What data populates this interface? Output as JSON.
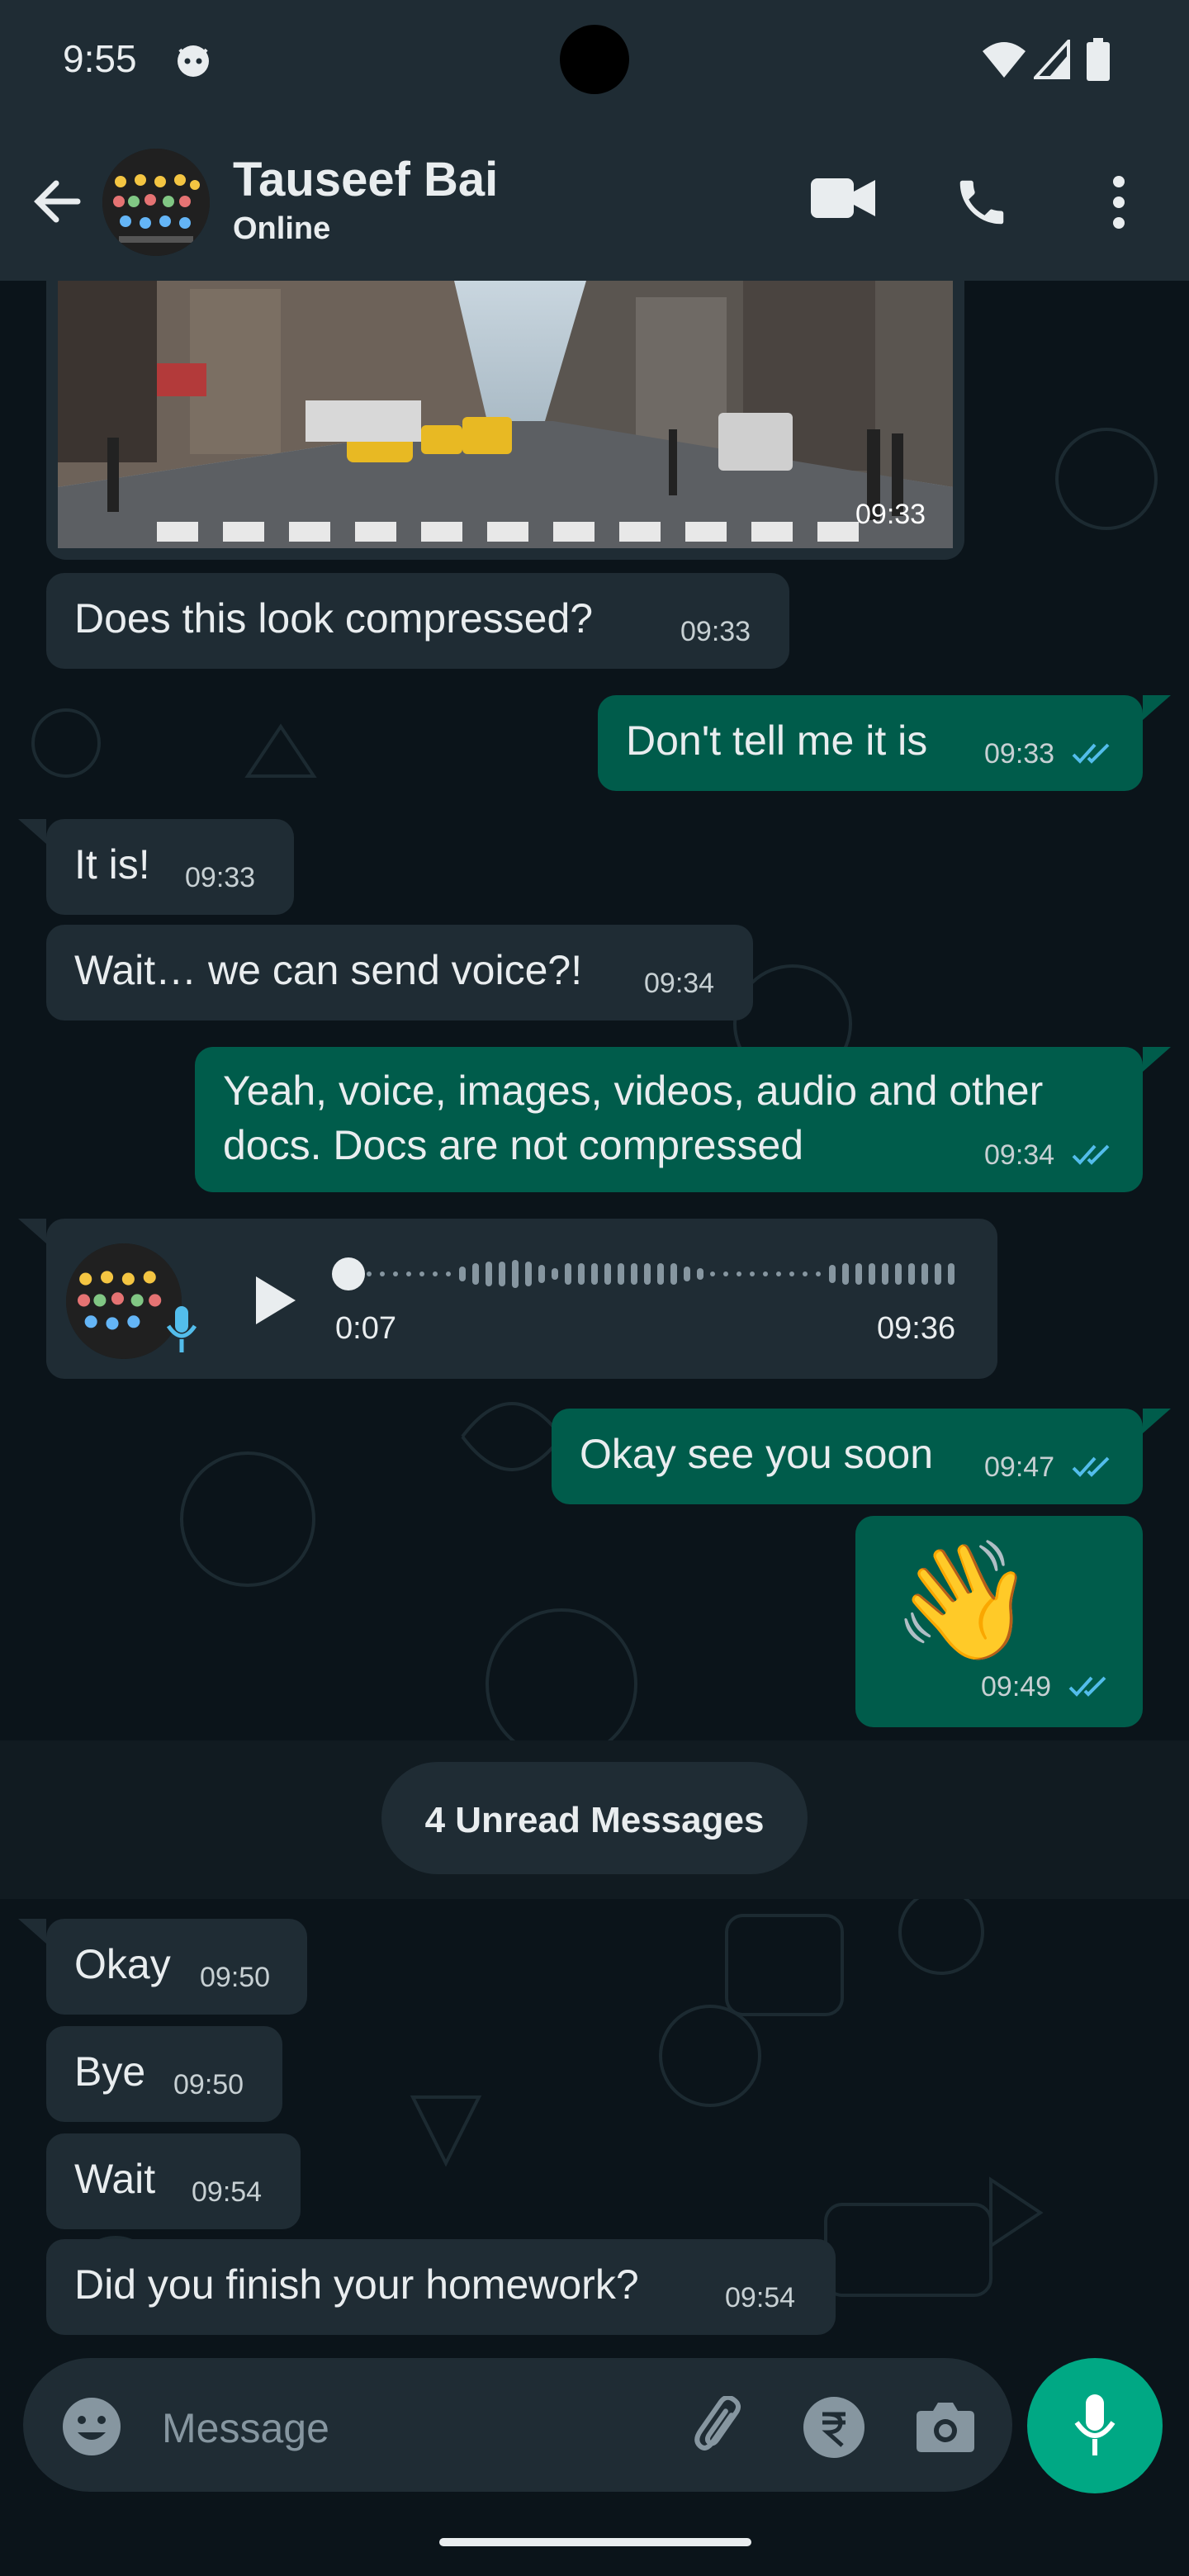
{
  "status_bar": {
    "time": "9:55"
  },
  "header": {
    "contact_name": "Tauseef Bai",
    "status": "Online"
  },
  "messages": [
    {
      "id": 0,
      "direction": "in",
      "type": "image",
      "time": "09:33"
    },
    {
      "id": 1,
      "direction": "in",
      "type": "text",
      "text": "Does this look compressed?",
      "time": "09:33"
    },
    {
      "id": 2,
      "direction": "out",
      "type": "text",
      "text": "Don't tell me it is",
      "time": "09:33"
    },
    {
      "id": 3,
      "direction": "in",
      "type": "text",
      "text": "It is!",
      "time": "09:33"
    },
    {
      "id": 4,
      "direction": "in",
      "type": "text",
      "text": "Wait… we can send voice?!",
      "time": "09:34"
    },
    {
      "id": 5,
      "direction": "out",
      "type": "text",
      "text_line1": "Yeah, voice, images, videos, audio and other",
      "text_line2": "docs. Docs are not compressed",
      "time": "09:34"
    },
    {
      "id": 6,
      "direction": "in",
      "type": "voice",
      "duration": "0:07",
      "time": "09:36"
    },
    {
      "id": 7,
      "direction": "out",
      "type": "text",
      "text": "Okay see you soon",
      "time": "09:47"
    },
    {
      "id": 8,
      "direction": "out",
      "type": "emoji",
      "text": "👋",
      "time": "09:49"
    },
    {
      "id": 9,
      "direction": "in",
      "type": "text",
      "text": "Okay",
      "time": "09:50"
    },
    {
      "id": 10,
      "direction": "in",
      "type": "text",
      "text": "Bye",
      "time": "09:50"
    },
    {
      "id": 11,
      "direction": "in",
      "type": "text",
      "text": "Wait",
      "time": "09:54"
    },
    {
      "id": 12,
      "direction": "in",
      "type": "text",
      "text": "Did you finish your homework?",
      "time": "09:54"
    }
  ],
  "voice_note": {
    "progress": 0.0
  },
  "unread_divider": {
    "label": "4 Unread Messages"
  },
  "composer": {
    "placeholder": "Message"
  },
  "icons": {
    "back": "arrow-left-icon",
    "video": "video-camera-icon",
    "call": "phone-icon",
    "menu": "more-vertical-icon",
    "emoji": "emoji-icon",
    "attach": "paperclip-icon",
    "payment": "rupee-icon",
    "camera": "camera-icon",
    "mic": "microphone-icon",
    "read": "double-check-icon"
  },
  "colors": {
    "header_bg": "#1f2c34",
    "chat_bg": "#0b141a",
    "incoming_bubble": "#1f2c34",
    "outgoing_bubble": "#005c4b",
    "accent": "#00a884",
    "read_tick": "#53bdeb"
  }
}
